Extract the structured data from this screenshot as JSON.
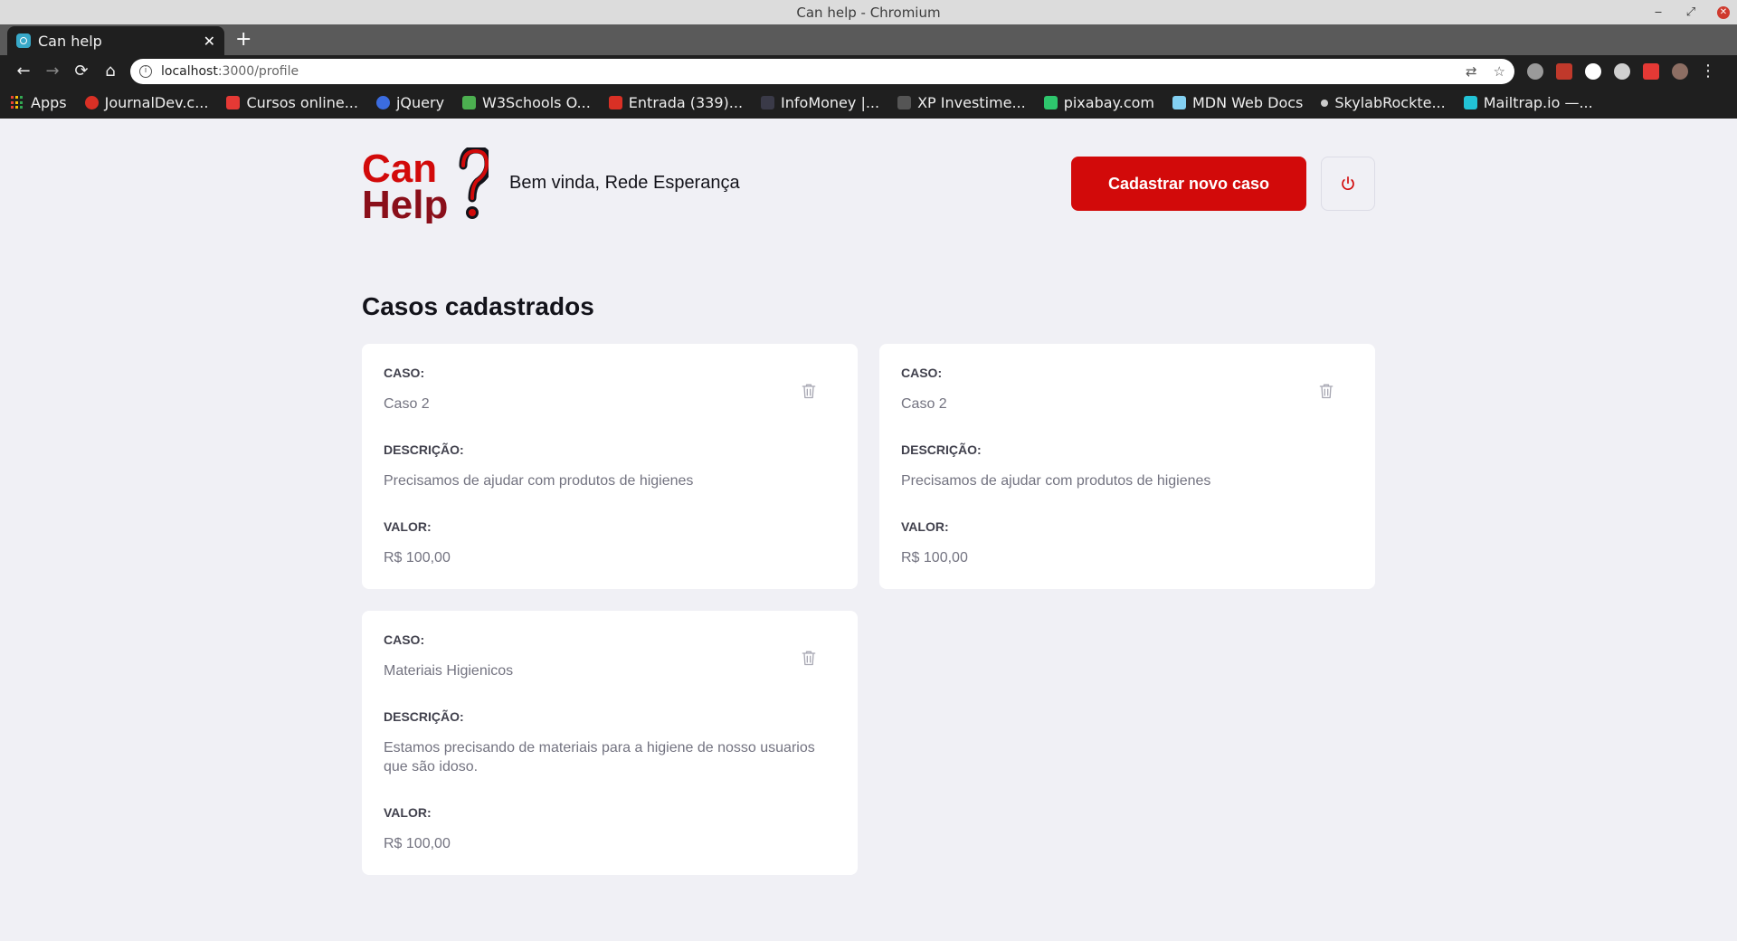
{
  "window": {
    "title": "Can help - Chromium",
    "controls": {
      "minimize": "‒",
      "maximize": "⤢",
      "close": "✕"
    }
  },
  "tab": {
    "title": "Can help",
    "close": "✕",
    "new_tab": "+"
  },
  "toolbar": {
    "back": "←",
    "forward": "→",
    "reload": "⟳",
    "home": "⌂",
    "url_host": "localhost",
    "url_path": ":3000/profile",
    "translate_icon": "⇄",
    "star_icon": "☆",
    "menu_icon": "⋮"
  },
  "bookmarks": [
    {
      "label": "Apps",
      "color": "#ea4335"
    },
    {
      "label": "JournalDev.c...",
      "color": "#d93025"
    },
    {
      "label": "Cursos online...",
      "color": "#e53935"
    },
    {
      "label": "jQuery",
      "color": "#3b6ce0"
    },
    {
      "label": "W3Schools O...",
      "color": "#4caf50"
    },
    {
      "label": "Entrada (339)...",
      "color": "#d93025"
    },
    {
      "label": "InfoMoney |...",
      "color": "#3a3a48"
    },
    {
      "label": "XP Investime...",
      "color": "#555555"
    },
    {
      "label": "pixabay.com",
      "color": "#2ec66d"
    },
    {
      "label": "MDN Web Docs",
      "color": "#83d0f2"
    },
    {
      "label": "SkylabRockte...",
      "color": "#cccccc"
    },
    {
      "label": "Mailtrap.io —...",
      "color": "#22c3d6"
    }
  ],
  "header": {
    "logo_line1": "Can",
    "logo_line2": "Help",
    "greeting": "Bem vinda, Rede Esperança",
    "new_case_button": "Cadastrar novo caso"
  },
  "section_title": "Casos cadastrados",
  "labels": {
    "case": "CASO:",
    "description": "DESCRIÇÃO:",
    "value": "VALOR:"
  },
  "cases": [
    {
      "title": "Caso 2",
      "description": "Precisamos de ajudar com produtos de higienes",
      "value": "R$ 100,00"
    },
    {
      "title": "Caso 2",
      "description": "Precisamos de ajudar com produtos de higienes",
      "value": "R$ 100,00"
    },
    {
      "title": "Materiais Higienicos",
      "description": "Estamos precisando de materiais para a higiene de nosso usuarios que são idoso.",
      "value": "R$ 100,00"
    }
  ],
  "colors": {
    "brand_red": "#d20a0a",
    "dark_red": "#8a0f1a",
    "background": "#f0f0f5",
    "text_dark": "#13131a",
    "text_muted": "#737380"
  }
}
